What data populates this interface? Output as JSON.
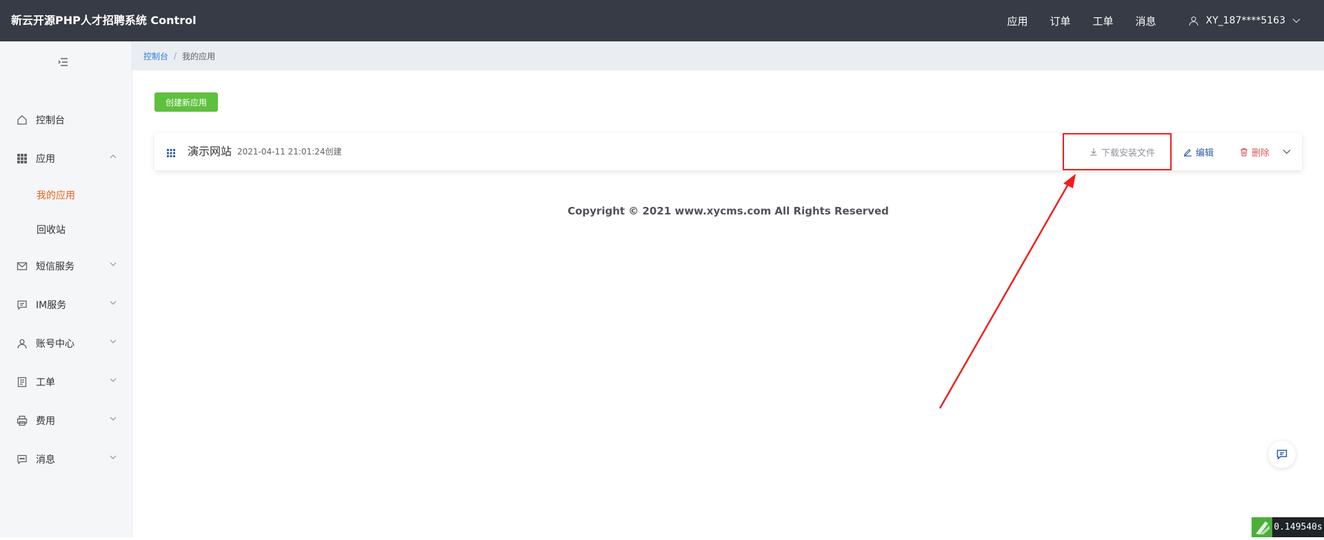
{
  "header": {
    "brand": "新云开源PHP人才招聘系统 Control",
    "nav": [
      "应用",
      "订单",
      "工单",
      "消息"
    ],
    "user": "XY_187****5163"
  },
  "sidebar": {
    "items": [
      {
        "label": "控制台",
        "icon": "home-icon"
      },
      {
        "label": "应用",
        "icon": "grid-icon",
        "expanded": true,
        "children": [
          {
            "label": "我的应用",
            "active": true
          },
          {
            "label": "回收站"
          }
        ]
      },
      {
        "label": "短信服务",
        "icon": "mail-icon"
      },
      {
        "label": "IM服务",
        "icon": "chat-icon"
      },
      {
        "label": "账号中心",
        "icon": "user-icon"
      },
      {
        "label": "工单",
        "icon": "document-icon"
      },
      {
        "label": "费用",
        "icon": "printer-icon"
      },
      {
        "label": "消息",
        "icon": "message-icon"
      }
    ]
  },
  "breadcrumb": {
    "root": "控制台",
    "sep": "/",
    "current": "我的应用"
  },
  "main": {
    "create_button": "创建新应用",
    "app": {
      "name": "演示网站",
      "created": "2021-04-11 21:01:24创建",
      "download": "下载安装文件",
      "edit": "编辑",
      "delete": "删除"
    },
    "copyright": "Copyright © 2021 www.xycms.com All Rights Reserved"
  },
  "debug": {
    "time": "0.149540s"
  },
  "colors": {
    "header_bg": "#363b45",
    "accent_orange": "#e8631b",
    "create_green": "#5ec13d",
    "annotation_red": "#f21d1d"
  }
}
